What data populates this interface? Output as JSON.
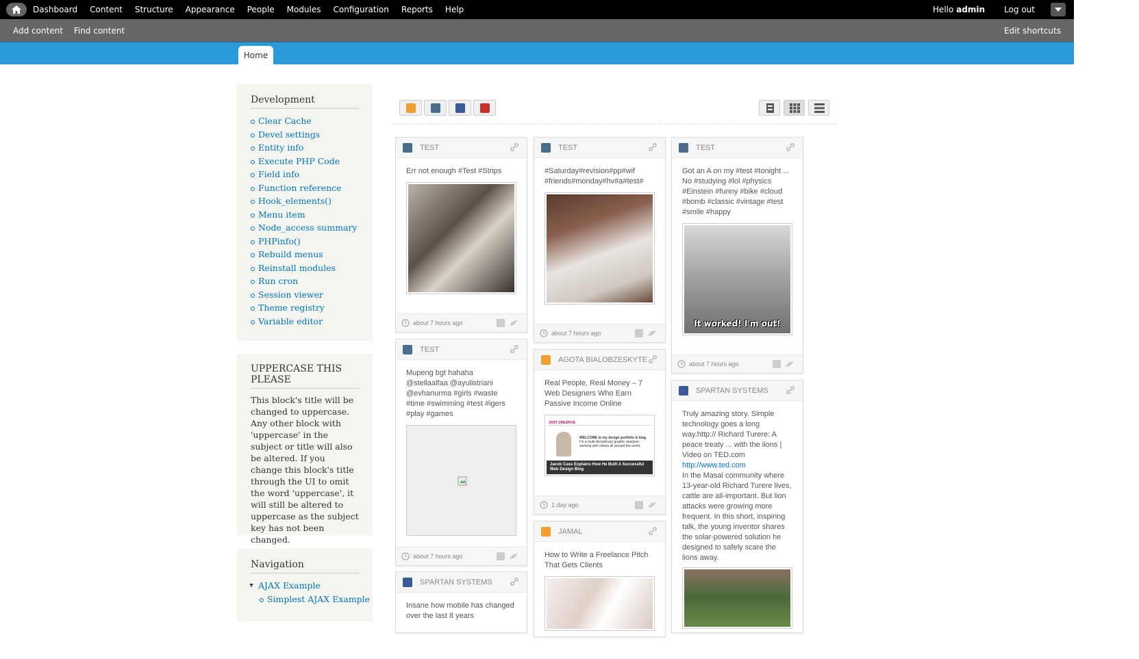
{
  "toolbar": {
    "menu": [
      "Dashboard",
      "Content",
      "Structure",
      "Appearance",
      "People",
      "Modules",
      "Configuration",
      "Reports",
      "Help"
    ],
    "hello_prefix": "Hello ",
    "username": "admin",
    "logout": "Log out"
  },
  "shortcuts": {
    "items": [
      "Add content",
      "Find content"
    ],
    "edit": "Edit shortcuts"
  },
  "tabs": [
    "Home"
  ],
  "development": {
    "title": "Development",
    "links": [
      "Clear Cache",
      "Devel settings",
      "Entity info",
      "Execute PHP Code",
      "Field info",
      "Function reference",
      "Hook_elements()",
      "Menu item",
      "Node_access summary",
      "PHPinfo()",
      "Rebuild menus",
      "Reinstall modules",
      "Run cron",
      "Session viewer",
      "Theme registry",
      "Variable editor"
    ]
  },
  "uppercase_block": {
    "title": "UPPERCASE THIS PLEASE",
    "body": "This block's title will be changed to uppercase. Any other block with 'uppercase' in the subject or title will also be altered. If you change this block's title through the UI to omit the word 'uppercase', it will still be altered to uppercase as the subject key has not been changed."
  },
  "navigation": {
    "title": "Navigation",
    "items": [
      "AJAX Example",
      "Simplest AJAX Example"
    ]
  },
  "cards": [
    {
      "source": "TEST",
      "network": "instagram",
      "text": "Err not enough #Test #Strips",
      "time": "about 7 hours ago"
    },
    {
      "source": "TEST",
      "network": "instagram",
      "text": "Mupeng bgt hahaha @stellaalfaa @ayulistriani @evhanurma #girls #waste #time #swimming #test #igers #play #games",
      "time": "about 7 hours ago"
    },
    {
      "source": "SPARTAN SYSTEMS",
      "network": "facebook",
      "text": "Insane how mobile has changed over the last 8 years"
    },
    {
      "source": "TEST",
      "network": "instagram",
      "text": "#Saturday#revision#pp#wif #friends#monday#hv#a#test#",
      "time": "about 7 hours ago"
    },
    {
      "source": "AGOTA BIALOBZESKYTE",
      "network": "blog",
      "text": "Real People, Real Money – 7 Web Designers Who Earn Passive Income Online",
      "time": "1 day ago"
    },
    {
      "source": "JAMAL",
      "network": "blog",
      "text": "How to Write a Freelance Pitch That Gets Clients"
    },
    {
      "source": "TEST",
      "network": "instagram",
      "text": "Got an A on my #test #tonight ... No #studying #lol #physics #Einstein #funny #bike #cloud #bomb #classic #vintage #test #smile #happy",
      "time": "about 7 hours ago",
      "caption": "It worked! I'm out!"
    },
    {
      "source": "SPARTAN SYSTEMS",
      "network": "facebook",
      "text1": "Truly amazing story. Simple technology goes a long way.http:// Richard Turere: A peace treaty ... with the lions | Video on TED.com",
      "link": "http://www.ted.com",
      "text2": "In the Masai community where 13-year-old Richard Turere lives, cattle are all-important. But lion attacks were growing more frequent. In this short, inspiring talk, the young inventor shares the solar-powered solution he designed to safely scare the lions away."
    }
  ],
  "blog_thumb": {
    "brand": "JUST CREATIVE",
    "welcome": "WELCOME to my design portfolio & blog.",
    "tagline": "I'm a multi-disciplinary graphic designer working with clients all around the world.",
    "banner": "Jacob Cass Explains How He Built A Successful Web Design Blog"
  },
  "colors": {
    "header_blue": "#2a9ad8",
    "link": "#0074bd",
    "toolbar": "#000000",
    "shortcuts": "#666666"
  }
}
